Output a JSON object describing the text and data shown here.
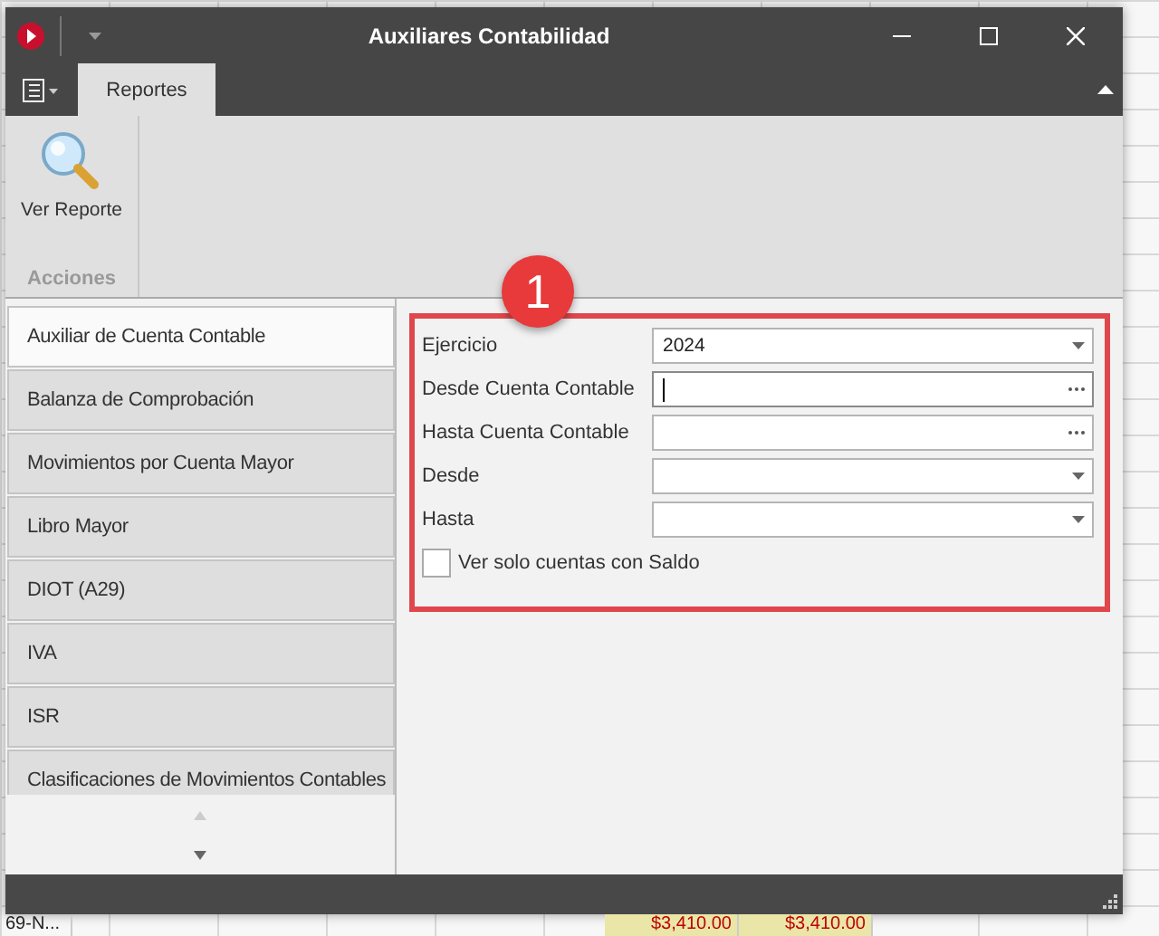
{
  "window": {
    "title": "Auxiliares Contabilidad"
  },
  "ribbon": {
    "tabs": [
      {
        "label": "Reportes",
        "selected": true
      }
    ],
    "groups": [
      {
        "label": "Acciones",
        "buttons": [
          {
            "label": "Ver Reporte"
          }
        ]
      }
    ]
  },
  "nav": {
    "items": [
      {
        "label": "Auxiliar de Cuenta Contable",
        "selected": true
      },
      {
        "label": "Balanza de Comprobación",
        "selected": false
      },
      {
        "label": "Movimientos por Cuenta Mayor",
        "selected": false
      },
      {
        "label": "Libro Mayor",
        "selected": false
      },
      {
        "label": "DIOT (A29)",
        "selected": false
      },
      {
        "label": "IVA",
        "selected": false
      },
      {
        "label": "ISR",
        "selected": false
      },
      {
        "label": "Clasificaciones de Movimientos Contables",
        "selected": false
      }
    ]
  },
  "callout": "1",
  "form": {
    "fields": [
      {
        "label": "Ejercicio",
        "kind": "dropdown",
        "value": "2024",
        "focused": false
      },
      {
        "label": "Desde Cuenta Contable",
        "kind": "lookup",
        "focused": true
      },
      {
        "label": "Hasta Cuenta Contable",
        "kind": "lookup",
        "focused": false
      },
      {
        "label": "Desde",
        "kind": "dropdown",
        "focused": false
      },
      {
        "label": "Hasta",
        "kind": "dropdown",
        "focused": false
      }
    ],
    "checkbox": {
      "label": "Ver solo cuentas con Saldo",
      "checked": false
    }
  },
  "background": {
    "cells": [
      "69-N...",
      "$3,410.00",
      "$3,410.00"
    ]
  }
}
